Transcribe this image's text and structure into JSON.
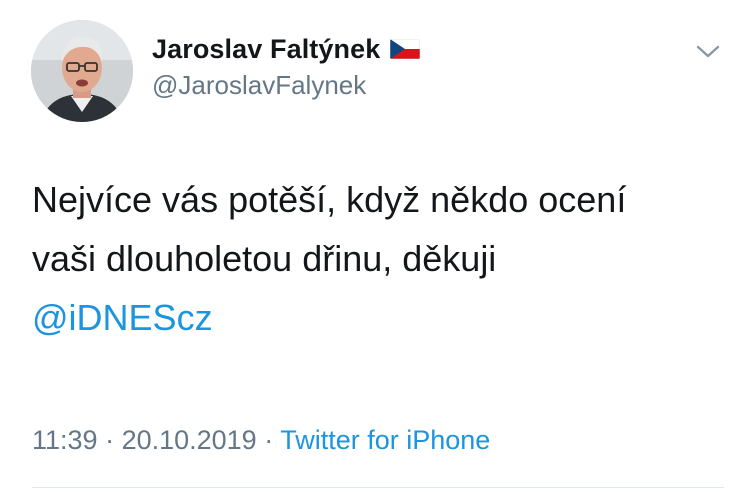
{
  "author": {
    "display_name": "Jaroslav Faltýnek",
    "handle": "@JaroslavFalynek",
    "flag_icon": "czech-flag-icon"
  },
  "tweet": {
    "line1": "Nejvíce vás potěší, když někdo ocení",
    "line2": "vaši dlouholetou dřinu, děkuji",
    "mention": "@iDNEScz"
  },
  "meta": {
    "time": "11:39",
    "separator1": " · ",
    "date": "20.10.2019",
    "separator2": " · ",
    "source": "Twitter for iPhone"
  },
  "colors": {
    "link": "#1b95e0",
    "secondary_text": "#657786",
    "primary_text": "#14171a"
  }
}
